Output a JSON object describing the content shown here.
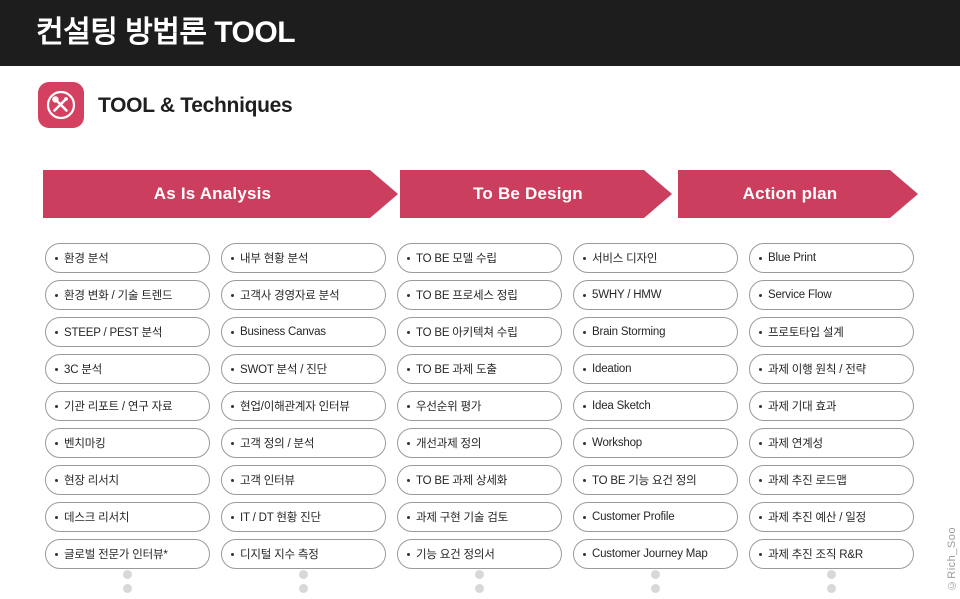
{
  "header": {
    "title": "컨설팅 방법론 TOOL",
    "background_color": "#1d1d1d",
    "text_color": "#ffffff"
  },
  "section": {
    "icon": "tools-crossed-icon",
    "title": "TOOL & Techniques",
    "accent_color": "#d4405f"
  },
  "phases": [
    {
      "label": "As Is Analysis",
      "color": "#cc3e5e"
    },
    {
      "label": "To Be Design",
      "color": "#cc3e5e"
    },
    {
      "label": "Action plan",
      "color": "#cc3e5e"
    }
  ],
  "columns": [
    {
      "id": "column-1",
      "phase": "As Is Analysis",
      "items": [
        "환경 분석",
        "환경 변화 / 기술 트렌드",
        "STEEP / PEST 분석",
        "3C 분석",
        "기관 리포트 / 연구 자료",
        "벤치마킹",
        "현장 리서치",
        "데스크 리서치",
        "글로벌 전문가 인터뷰*"
      ]
    },
    {
      "id": "column-2",
      "phase": "As Is Analysis",
      "items": [
        "내부 현황 분석",
        "고객사 경영자료 분석",
        "Business Canvas",
        "SWOT 분석 / 진단",
        "현업/이해관계자 인터뷰",
        "고객 정의 / 분석",
        "고객 인터뷰",
        "IT / DT 현황 진단",
        "디지털 지수 측정"
      ]
    },
    {
      "id": "column-3",
      "phase": "To Be Design",
      "items": [
        "TO BE 모델 수립",
        "TO BE 프로세스 정립",
        "TO BE 아키텍쳐 수립",
        "TO BE 과제 도출",
        "우선순위 평가",
        "개선과제 정의",
        "TO BE 과제 상세화",
        "과제 구현 기술 검토",
        "기능 요건 정의서"
      ]
    },
    {
      "id": "column-4",
      "phase": "To Be Design",
      "items": [
        "서비스 디자인",
        "5WHY / HMW",
        "Brain Storming",
        "Ideation",
        "Idea Sketch",
        "Workshop",
        "TO BE 기능 요건 정의",
        "Customer Profile",
        "Customer Journey Map"
      ]
    },
    {
      "id": "column-5",
      "phase": "Action plan",
      "items": [
        "Blue Print",
        "Service Flow",
        "프로토타입 설계",
        "과제 이행 원칙 / 전략",
        "과제 기대 효과",
        "과제 연계성",
        "과제 추진 로드맵",
        "과제 추진 예산 / 일정",
        "과제 추진 조직 R&R"
      ]
    }
  ],
  "footer": {
    "dots_per_column": 2,
    "dot_color": "#d8d8d8",
    "watermark": "©Rich_Soo"
  }
}
